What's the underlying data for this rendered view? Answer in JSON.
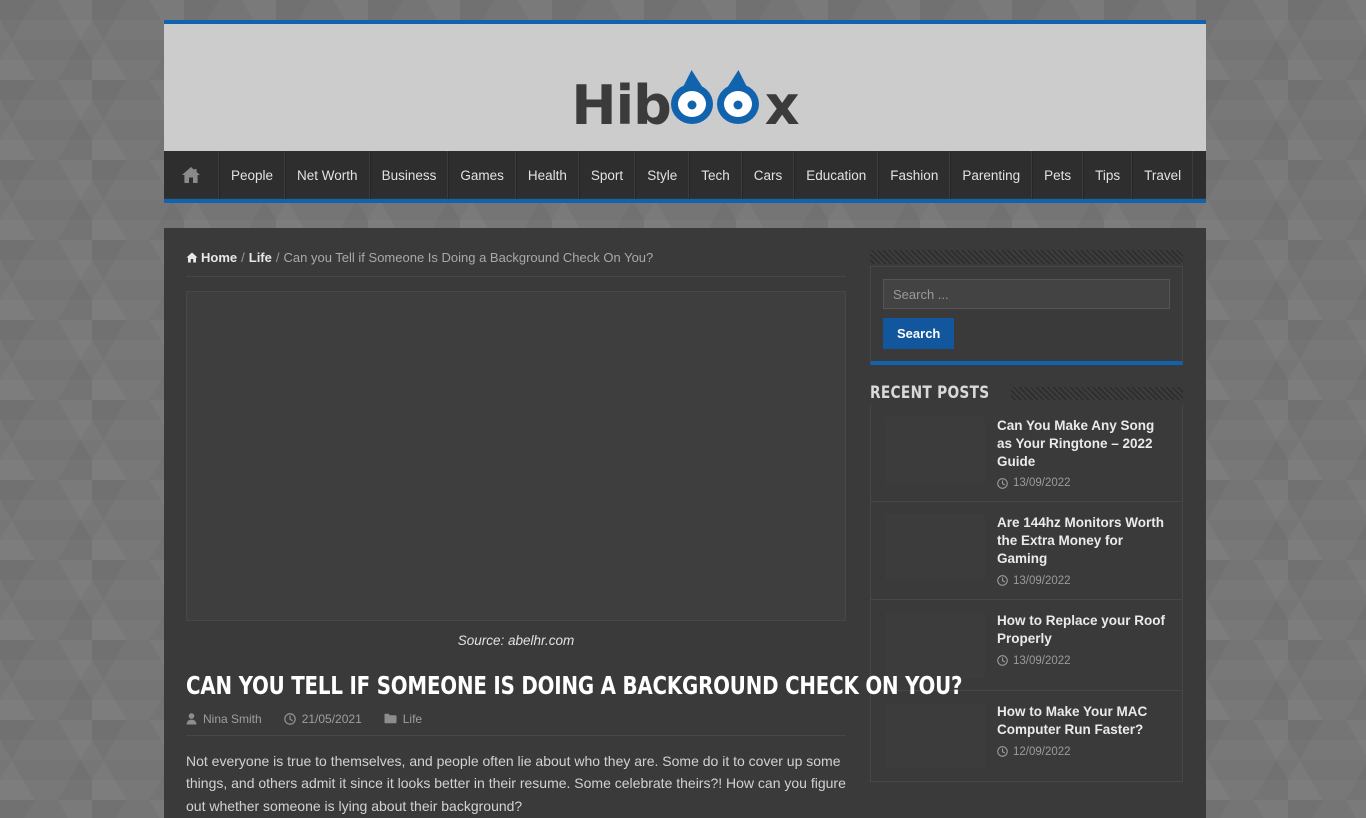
{
  "site": {
    "logo": {
      "prefix": "Hib",
      "suffix": "x",
      "alt": "Hiboox",
      "accent_color": "#1263ad"
    },
    "accent_color": "#1263ad",
    "background_color": "#757575"
  },
  "nav": {
    "home_icon": "home-icon",
    "items": [
      {
        "label": "People"
      },
      {
        "label": "Net Worth"
      },
      {
        "label": "Business"
      },
      {
        "label": "Games"
      },
      {
        "label": "Health"
      },
      {
        "label": "Sport"
      },
      {
        "label": "Style"
      },
      {
        "label": "Tech"
      },
      {
        "label": "Cars"
      },
      {
        "label": "Education"
      },
      {
        "label": "Fashion"
      },
      {
        "label": "Parenting"
      },
      {
        "label": "Pets"
      },
      {
        "label": "Tips"
      },
      {
        "label": "Travel"
      }
    ]
  },
  "breadcrumb": {
    "home": "Home",
    "sep1": "/",
    "category": "Life",
    "sep2": "/",
    "current": "Can you Tell if Someone Is Doing a Background Check On You?"
  },
  "article": {
    "image_caption": "Source: abelhr.com",
    "title": "Can You Tell if Someone Is Doing a Background Check On You?",
    "author": "Nina Smith",
    "date": "21/05/2021",
    "category": "Life",
    "body": "Not everyone is true to themselves, and people often lie about who they are. Some do it to cover up some things, and others admit it since it looks better in their resume. Some celebrate theirs?! How can you figure out whether someone is lying about their background?"
  },
  "sidebar": {
    "search": {
      "placeholder": "Search ...",
      "value": "",
      "button_label": "Search"
    },
    "recent_posts": {
      "title": "Recent Posts",
      "items": [
        {
          "title": "Can You Make Any Song as Your Ringtone – 2022 Guide",
          "date": "13/09/2022"
        },
        {
          "title": "Are 144hz Monitors Worth the Extra Money for Gaming",
          "date": "13/09/2022"
        },
        {
          "title": "How to Replace your Roof Properly",
          "date": "13/09/2022"
        },
        {
          "title": "How to Make Your MAC Computer Run Faster?",
          "date": "12/09/2022"
        }
      ]
    }
  }
}
